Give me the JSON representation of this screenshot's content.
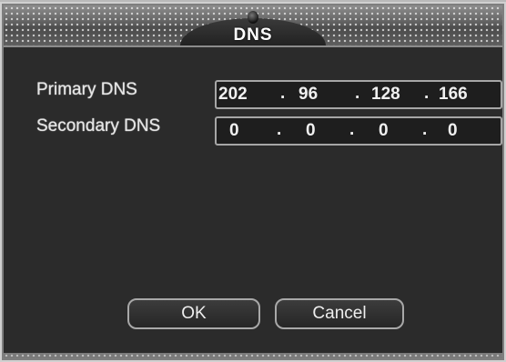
{
  "dialog": {
    "title": "DNS"
  },
  "fields": {
    "primary": {
      "label": "Primary DNS",
      "octets": [
        "202",
        "96",
        "128",
        "166"
      ]
    },
    "secondary": {
      "label": "Secondary DNS",
      "octets": [
        "0",
        "0",
        "0",
        "0"
      ]
    },
    "separator": "."
  },
  "buttons": {
    "ok_label": "OK",
    "cancel_label": "Cancel"
  }
}
